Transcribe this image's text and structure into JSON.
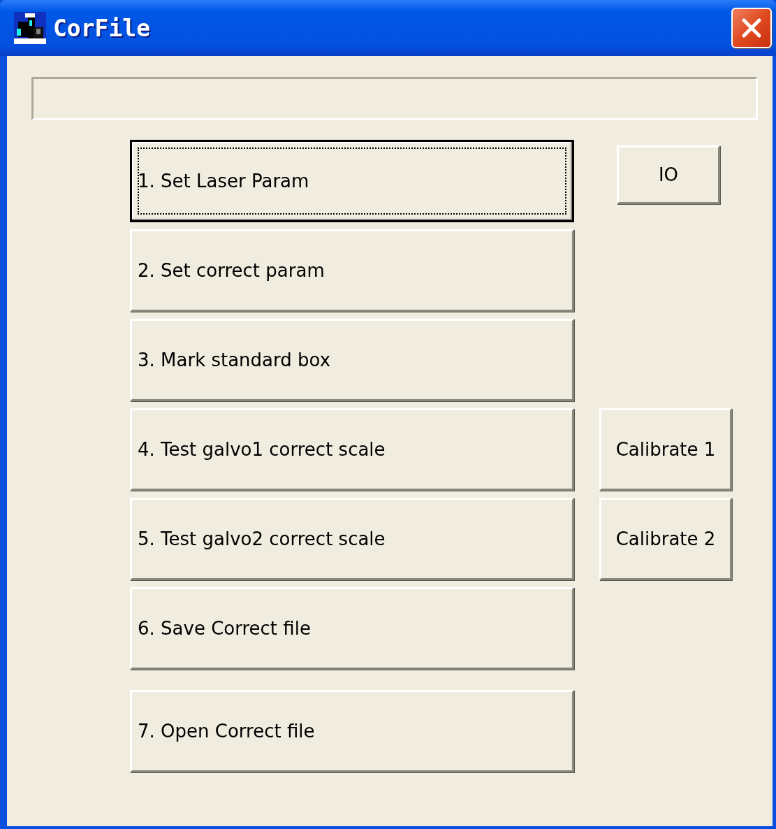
{
  "window": {
    "title": "CorFile"
  },
  "rows": [
    {
      "label": "1. Set Laser Param",
      "focused": true,
      "side": {
        "label": "IO",
        "kind": "compact"
      }
    },
    {
      "label": "2. Set correct param",
      "focused": false
    },
    {
      "label": "3. Mark standard box",
      "focused": false
    },
    {
      "label": "4. Test galvo1 correct scale",
      "focused": false,
      "side": {
        "label": "Calibrate 1",
        "kind": "full"
      }
    },
    {
      "label": "5. Test galvo2 correct scale",
      "focused": false,
      "side": {
        "label": "Calibrate 2",
        "kind": "full"
      }
    },
    {
      "label": "6. Save Correct file",
      "focused": false
    },
    {
      "label": "7. Open Correct file",
      "focused": false
    }
  ]
}
